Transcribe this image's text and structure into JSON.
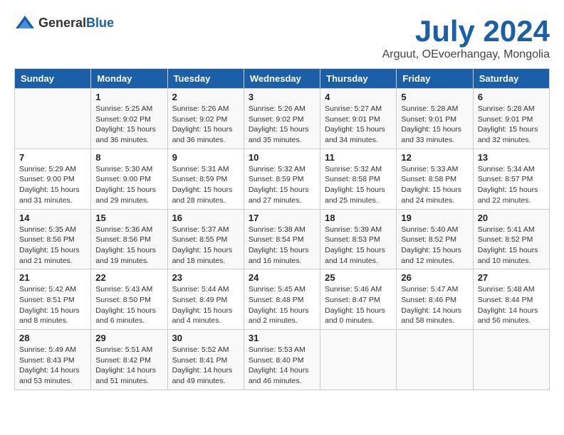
{
  "header": {
    "logo": {
      "general": "General",
      "blue": "Blue"
    },
    "month_year": "July 2024",
    "location": "Arguut, OEvoerhangay, Mongolia"
  },
  "calendar": {
    "days_of_week": [
      "Sunday",
      "Monday",
      "Tuesday",
      "Wednesday",
      "Thursday",
      "Friday",
      "Saturday"
    ],
    "weeks": [
      [
        {
          "day": "",
          "content": ""
        },
        {
          "day": "1",
          "content": "Sunrise: 5:25 AM\nSunset: 9:02 PM\nDaylight: 15 hours\nand 36 minutes."
        },
        {
          "day": "2",
          "content": "Sunrise: 5:26 AM\nSunset: 9:02 PM\nDaylight: 15 hours\nand 36 minutes."
        },
        {
          "day": "3",
          "content": "Sunrise: 5:26 AM\nSunset: 9:02 PM\nDaylight: 15 hours\nand 35 minutes."
        },
        {
          "day": "4",
          "content": "Sunrise: 5:27 AM\nSunset: 9:01 PM\nDaylight: 15 hours\nand 34 minutes."
        },
        {
          "day": "5",
          "content": "Sunrise: 5:28 AM\nSunset: 9:01 PM\nDaylight: 15 hours\nand 33 minutes."
        },
        {
          "day": "6",
          "content": "Sunrise: 5:28 AM\nSunset: 9:01 PM\nDaylight: 15 hours\nand 32 minutes."
        }
      ],
      [
        {
          "day": "7",
          "content": "Sunrise: 5:29 AM\nSunset: 9:00 PM\nDaylight: 15 hours\nand 31 minutes."
        },
        {
          "day": "8",
          "content": "Sunrise: 5:30 AM\nSunset: 9:00 PM\nDaylight: 15 hours\nand 29 minutes."
        },
        {
          "day": "9",
          "content": "Sunrise: 5:31 AM\nSunset: 8:59 PM\nDaylight: 15 hours\nand 28 minutes."
        },
        {
          "day": "10",
          "content": "Sunrise: 5:32 AM\nSunset: 8:59 PM\nDaylight: 15 hours\nand 27 minutes."
        },
        {
          "day": "11",
          "content": "Sunrise: 5:32 AM\nSunset: 8:58 PM\nDaylight: 15 hours\nand 25 minutes."
        },
        {
          "day": "12",
          "content": "Sunrise: 5:33 AM\nSunset: 8:58 PM\nDaylight: 15 hours\nand 24 minutes."
        },
        {
          "day": "13",
          "content": "Sunrise: 5:34 AM\nSunset: 8:57 PM\nDaylight: 15 hours\nand 22 minutes."
        }
      ],
      [
        {
          "day": "14",
          "content": "Sunrise: 5:35 AM\nSunset: 8:56 PM\nDaylight: 15 hours\nand 21 minutes."
        },
        {
          "day": "15",
          "content": "Sunrise: 5:36 AM\nSunset: 8:56 PM\nDaylight: 15 hours\nand 19 minutes."
        },
        {
          "day": "16",
          "content": "Sunrise: 5:37 AM\nSunset: 8:55 PM\nDaylight: 15 hours\nand 18 minutes."
        },
        {
          "day": "17",
          "content": "Sunrise: 5:38 AM\nSunset: 8:54 PM\nDaylight: 15 hours\nand 16 minutes."
        },
        {
          "day": "18",
          "content": "Sunrise: 5:39 AM\nSunset: 8:53 PM\nDaylight: 15 hours\nand 14 minutes."
        },
        {
          "day": "19",
          "content": "Sunrise: 5:40 AM\nSunset: 8:52 PM\nDaylight: 15 hours\nand 12 minutes."
        },
        {
          "day": "20",
          "content": "Sunrise: 5:41 AM\nSunset: 8:52 PM\nDaylight: 15 hours\nand 10 minutes."
        }
      ],
      [
        {
          "day": "21",
          "content": "Sunrise: 5:42 AM\nSunset: 8:51 PM\nDaylight: 15 hours\nand 8 minutes."
        },
        {
          "day": "22",
          "content": "Sunrise: 5:43 AM\nSunset: 8:50 PM\nDaylight: 15 hours\nand 6 minutes."
        },
        {
          "day": "23",
          "content": "Sunrise: 5:44 AM\nSunset: 8:49 PM\nDaylight: 15 hours\nand 4 minutes."
        },
        {
          "day": "24",
          "content": "Sunrise: 5:45 AM\nSunset: 8:48 PM\nDaylight: 15 hours\nand 2 minutes."
        },
        {
          "day": "25",
          "content": "Sunrise: 5:46 AM\nSunset: 8:47 PM\nDaylight: 15 hours\nand 0 minutes."
        },
        {
          "day": "26",
          "content": "Sunrise: 5:47 AM\nSunset: 8:46 PM\nDaylight: 14 hours\nand 58 minutes."
        },
        {
          "day": "27",
          "content": "Sunrise: 5:48 AM\nSunset: 8:44 PM\nDaylight: 14 hours\nand 56 minutes."
        }
      ],
      [
        {
          "day": "28",
          "content": "Sunrise: 5:49 AM\nSunset: 8:43 PM\nDaylight: 14 hours\nand 53 minutes."
        },
        {
          "day": "29",
          "content": "Sunrise: 5:51 AM\nSunset: 8:42 PM\nDaylight: 14 hours\nand 51 minutes."
        },
        {
          "day": "30",
          "content": "Sunrise: 5:52 AM\nSunset: 8:41 PM\nDaylight: 14 hours\nand 49 minutes."
        },
        {
          "day": "31",
          "content": "Sunrise: 5:53 AM\nSunset: 8:40 PM\nDaylight: 14 hours\nand 46 minutes."
        },
        {
          "day": "",
          "content": ""
        },
        {
          "day": "",
          "content": ""
        },
        {
          "day": "",
          "content": ""
        }
      ]
    ]
  }
}
